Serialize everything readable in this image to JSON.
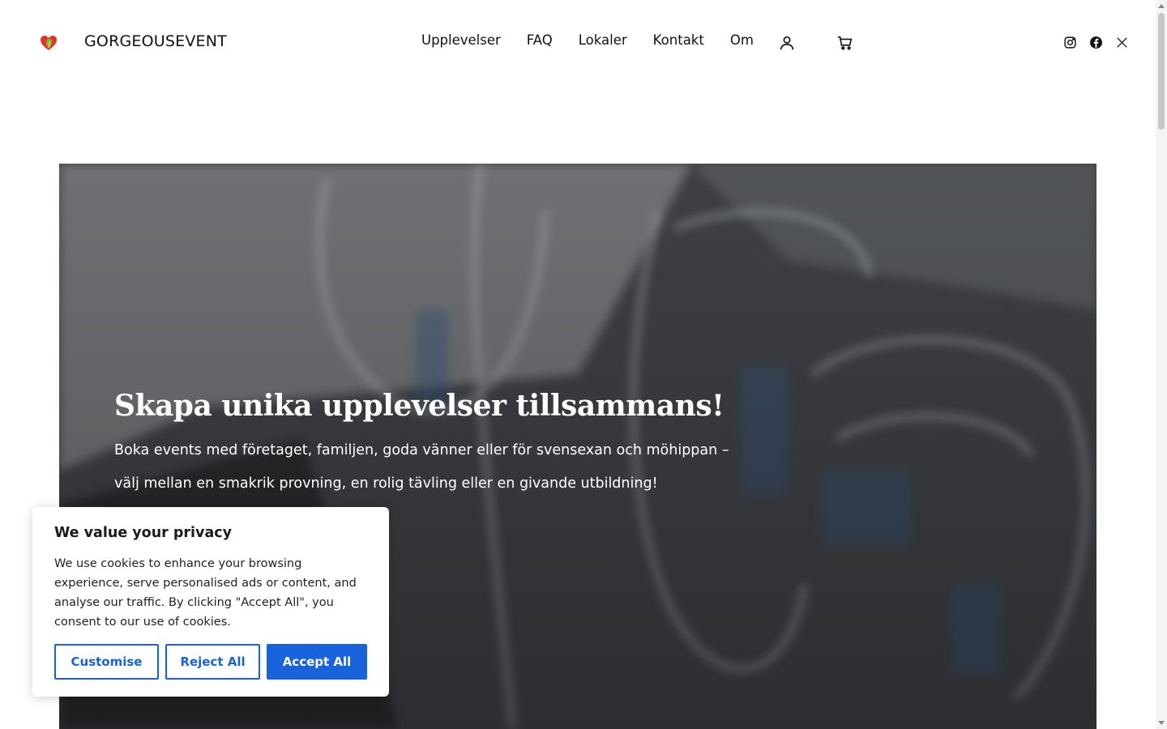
{
  "header": {
    "brand": "GORGEOUSEVENT",
    "logo_icon": "heart-logo-icon",
    "nav": [
      {
        "label": "Upplevelser"
      },
      {
        "label": "FAQ"
      },
      {
        "label": "Lokaler"
      },
      {
        "label": "Kontakt"
      },
      {
        "label": "Om"
      }
    ],
    "account_icon": "user-icon",
    "cart_icon": "cart-icon",
    "social": [
      "instagram-icon",
      "facebook-icon",
      "x-icon"
    ]
  },
  "hero": {
    "title": "Skapa unika upplevelser tillsammans!",
    "text_line1": "Boka events med företaget, familjen, goda vänner eller för svensexan och möhippan –",
    "text_line2": "välj mellan en smakrik provning, en rolig tävling eller en givande utbildning!"
  },
  "cookie": {
    "title": "We value your privacy",
    "text": "We use cookies to enhance your browsing experience, serve personalised ads or content, and analyse our traffic. By clicking \"Accept All\", you consent to our use of cookies.",
    "customise": "Customise",
    "reject": "Reject All",
    "accept": "Accept All"
  },
  "colors": {
    "accent": "#1863dc",
    "text": "#111111",
    "hero_overlay": "#3a3c40"
  }
}
